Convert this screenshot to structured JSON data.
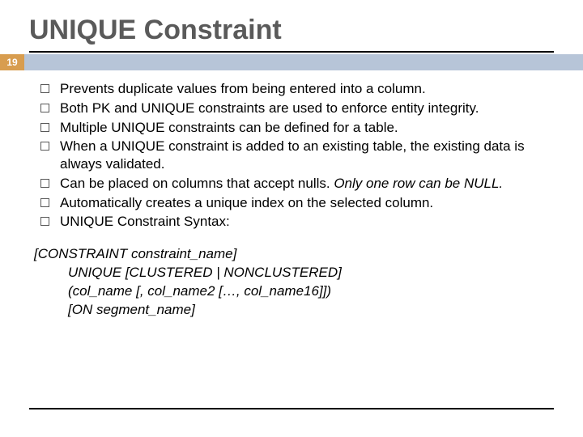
{
  "page_number": "19",
  "title": "UNIQUE Constraint",
  "bullets": [
    "Prevents duplicate values from being entered into a column.",
    "Both PK and UNIQUE constraints are used to enforce entity integrity.",
    "Multiple UNIQUE constraints can be defined for a table.",
    "When a UNIQUE constraint is added to an existing table, the existing data is always validated.",
    "Can be placed on columns that accept nulls.  Only one row can be NULL.",
    "Automatically creates a unique index on the selected column.",
    "UNIQUE Constraint Syntax:"
  ],
  "bullet5_prefix": "Can be placed on columns that accept nulls.  ",
  "bullet5_emph": "Only one row can be NULL.",
  "syntax": {
    "l1": "[CONSTRAINT constraint_name]",
    "l2": "UNIQUE [CLUSTERED | NONCLUSTERED]",
    "l3": "(col_name [, col_name2 […, col_name16]])",
    "l4": "[ON segment_name]"
  }
}
